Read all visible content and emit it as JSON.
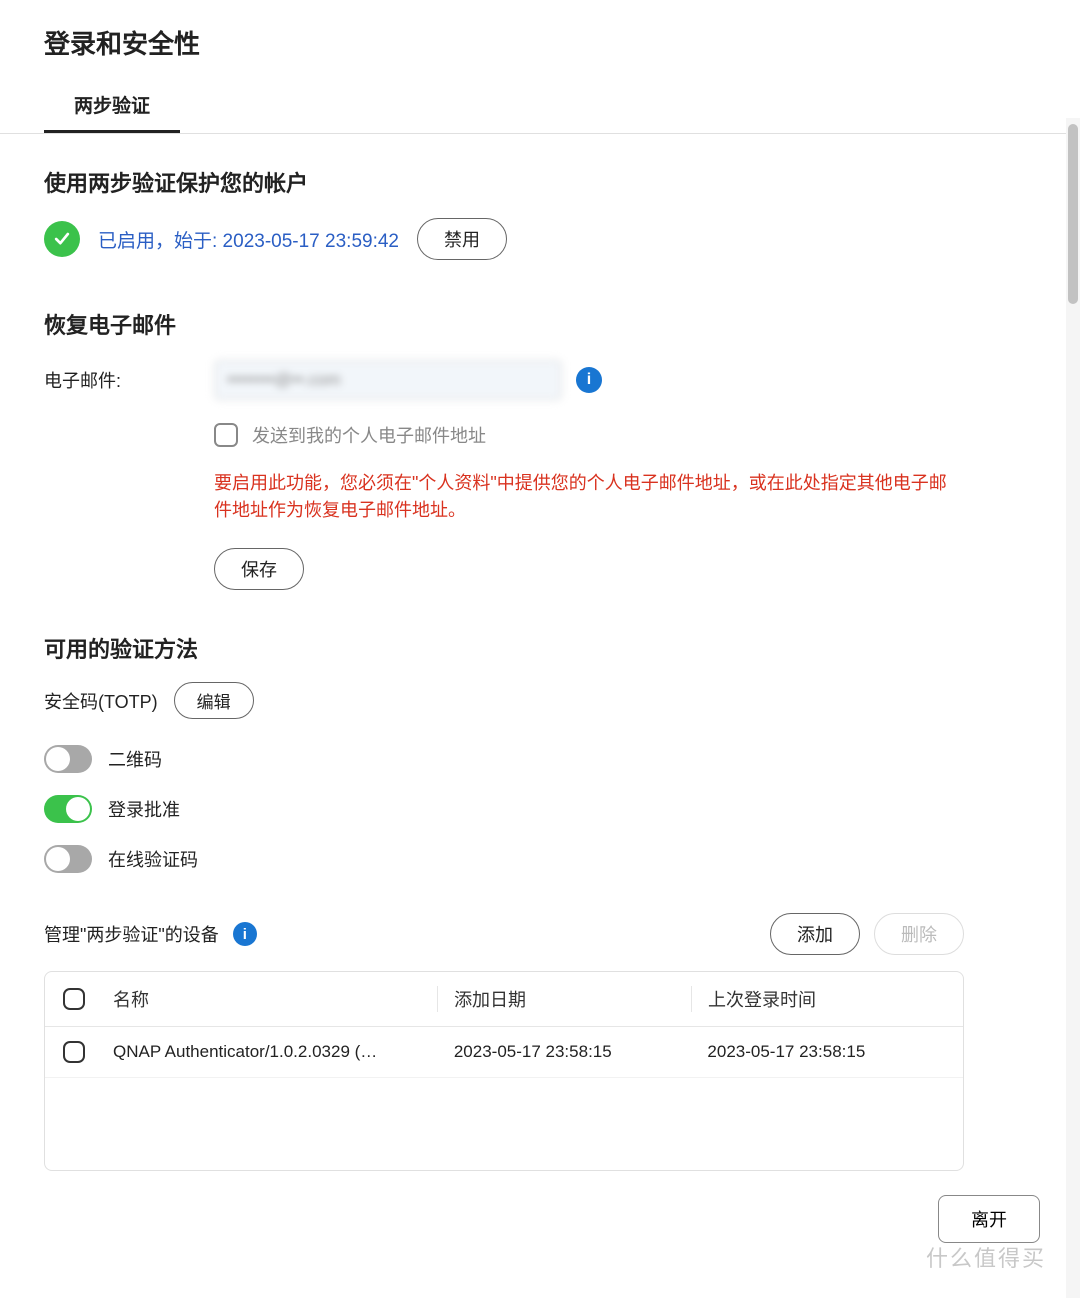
{
  "page_title": "登录和安全性",
  "tabs": [
    {
      "label": "两步验证",
      "active": true
    }
  ],
  "protect": {
    "title": "使用两步验证保护您的帐户",
    "status_text": "已启用，始于: 2023-05-17 23:59:42",
    "disable_btn": "禁用"
  },
  "recovery": {
    "title": "恢复电子邮件",
    "email_label": "电子邮件:",
    "email_value": "••••••••@••.com",
    "send_checkbox_label": "发送到我的个人电子邮件地址",
    "warning": "要启用此功能，您必须在\"个人资料\"中提供您的个人电子邮件地址，或在此处指定其他电子邮件地址作为恢复电子邮件地址。",
    "save_btn": "保存"
  },
  "methods": {
    "title": "可用的验证方法",
    "totp_label": "安全码(TOTP)",
    "edit_btn": "编辑",
    "toggles": [
      {
        "name": "qrcode",
        "label": "二维码",
        "on": false
      },
      {
        "name": "login-approval",
        "label": "登录批准",
        "on": true
      },
      {
        "name": "online-code",
        "label": "在线验证码",
        "on": false
      }
    ]
  },
  "devices": {
    "title": "管理\"两步验证\"的设备",
    "add_btn": "添加",
    "delete_btn": "删除",
    "columns": {
      "name": "名称",
      "added": "添加日期",
      "last_login": "上次登录时间"
    },
    "rows": [
      {
        "name": "QNAP Authenticator/1.0.2.0329 (…",
        "added": "2023-05-17 23:58:15",
        "last_login": "2023-05-17 23:58:15"
      }
    ]
  },
  "footer": {
    "leave_btn": "离开"
  },
  "watermark": "什么值得买"
}
